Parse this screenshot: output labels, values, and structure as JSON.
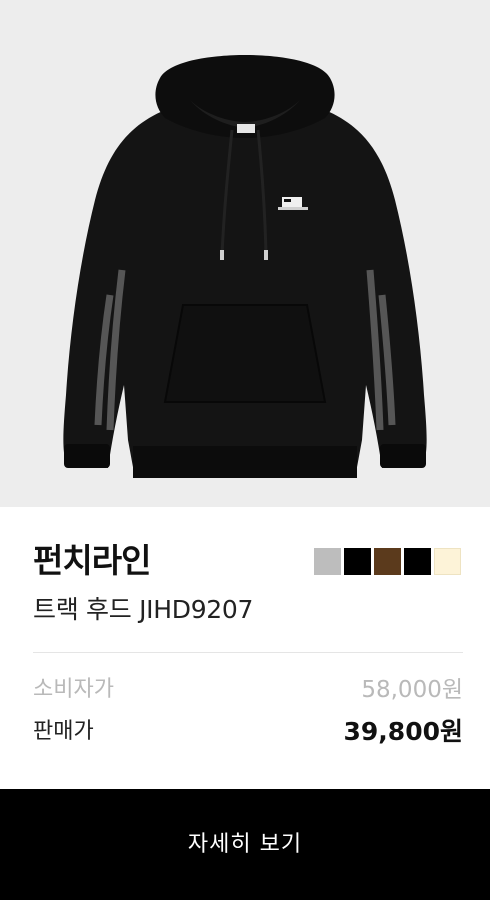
{
  "product": {
    "brand": "펀치라인",
    "name": "트랙 후드 JIHD9207",
    "image_icon": "black-hoodie-image",
    "colors": [
      "#bdbdbd",
      "#000000",
      "#5b3a1c",
      "#000000",
      "#fdf3d8"
    ]
  },
  "pricing": {
    "retail_label": "소비자가",
    "retail_value": "58,000원",
    "sale_label": "판매가",
    "sale_value": "39,800원"
  },
  "cta": {
    "label": "자세히 보기"
  }
}
